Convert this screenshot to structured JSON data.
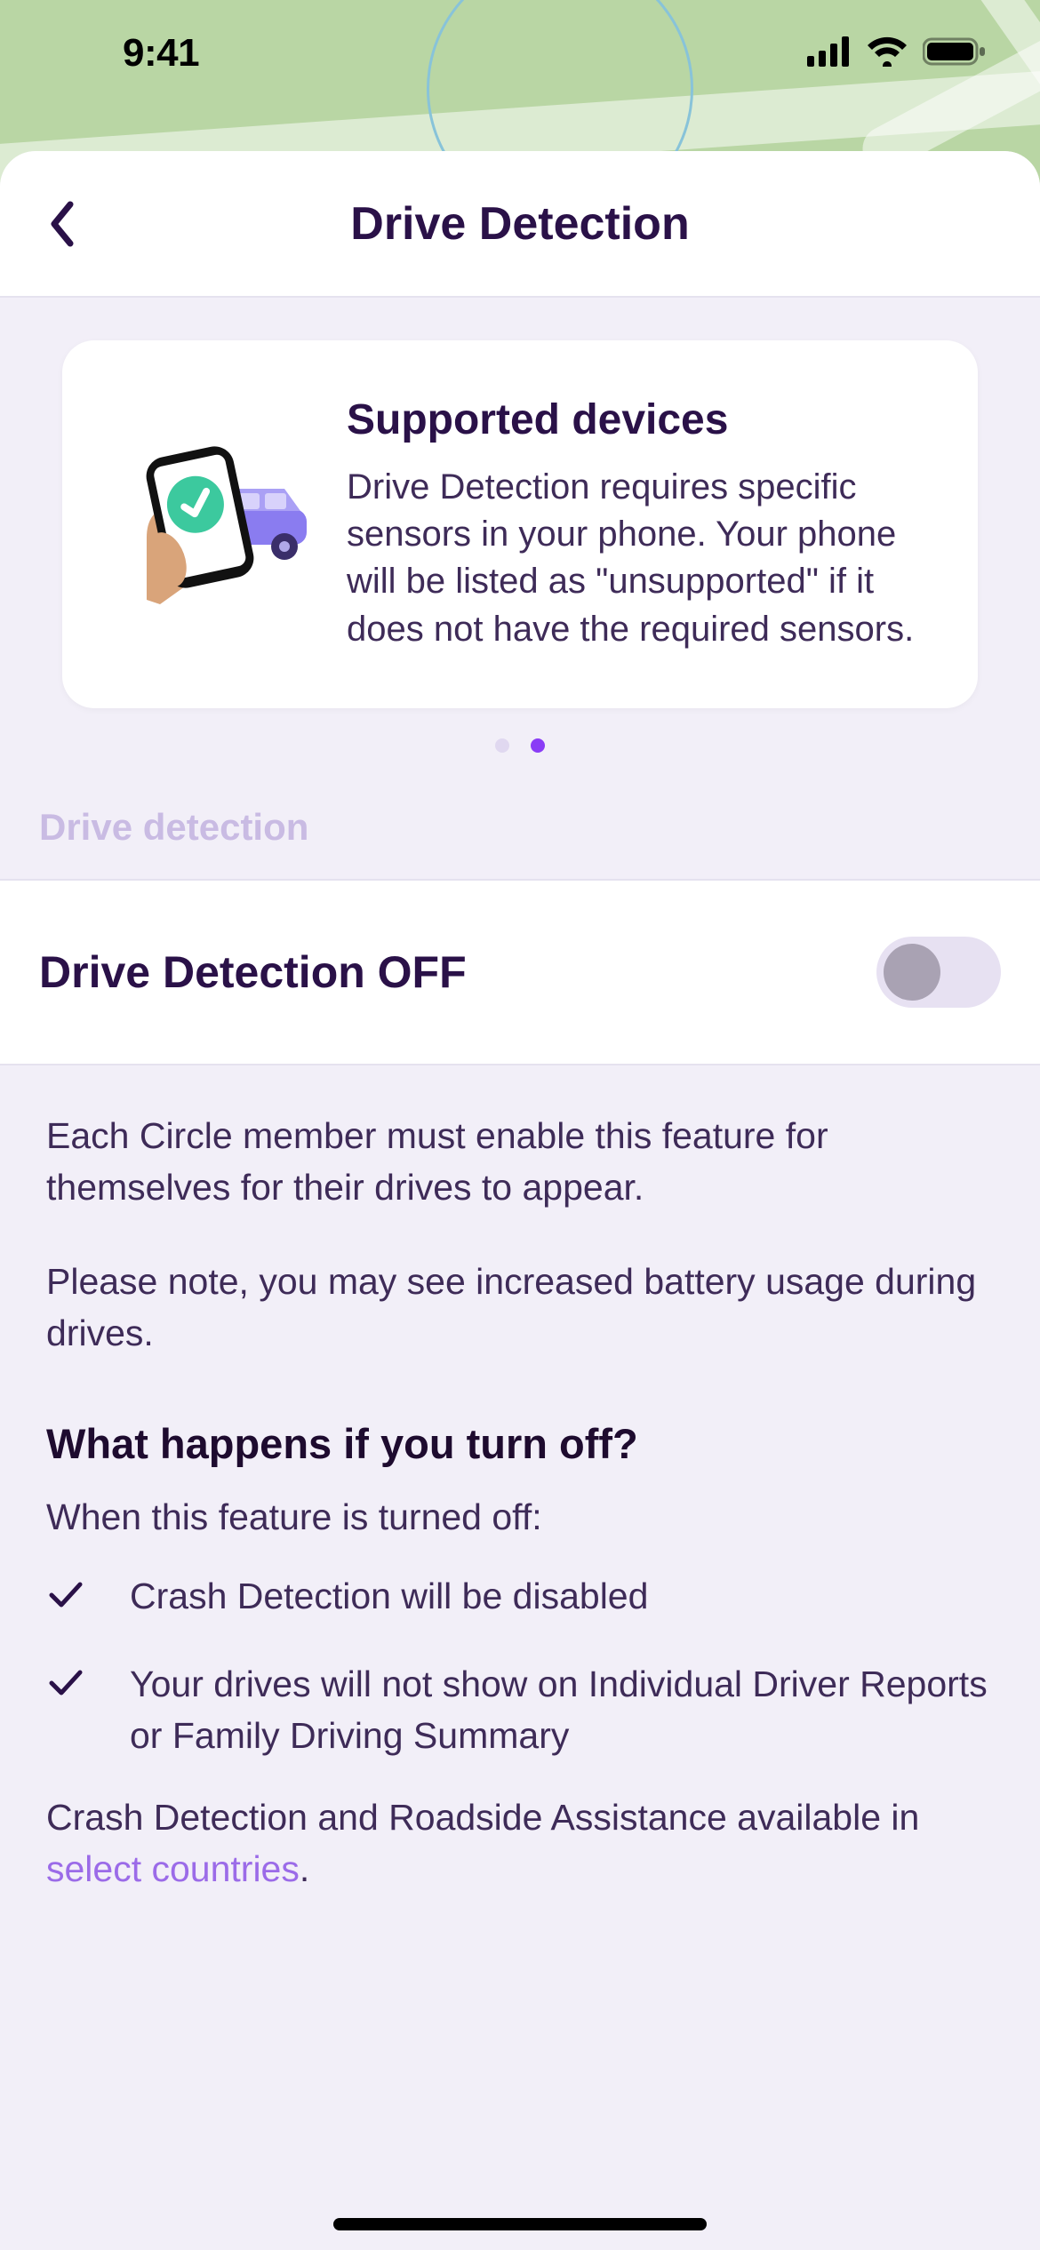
{
  "status": {
    "time": "9:41"
  },
  "nav": {
    "title": "Drive Detection"
  },
  "card": {
    "title": "Supported devices",
    "body": "Drive Detection requires specific sensors in your phone. Your phone will be listed as \"unsupported\" if it does not have the required sensors."
  },
  "section_label": "Drive detection",
  "toggle": {
    "label": "Drive Detection OFF"
  },
  "info": {
    "p1": "Each Circle member must enable this feature for themselves for their drives to appear.",
    "p2": "Please note, you may see increased battery usage during drives.",
    "h3": "What happens if you turn off?",
    "sub": "When this feature is turned off:",
    "b1": "Crash Detection will be disabled",
    "b2": "Your drives will not show on Individual Driver Reports or Family Driving Summary",
    "footer_pre": "Crash Detection and Roadside Assistance available in ",
    "footer_link": "select countries",
    "footer_post": "."
  }
}
